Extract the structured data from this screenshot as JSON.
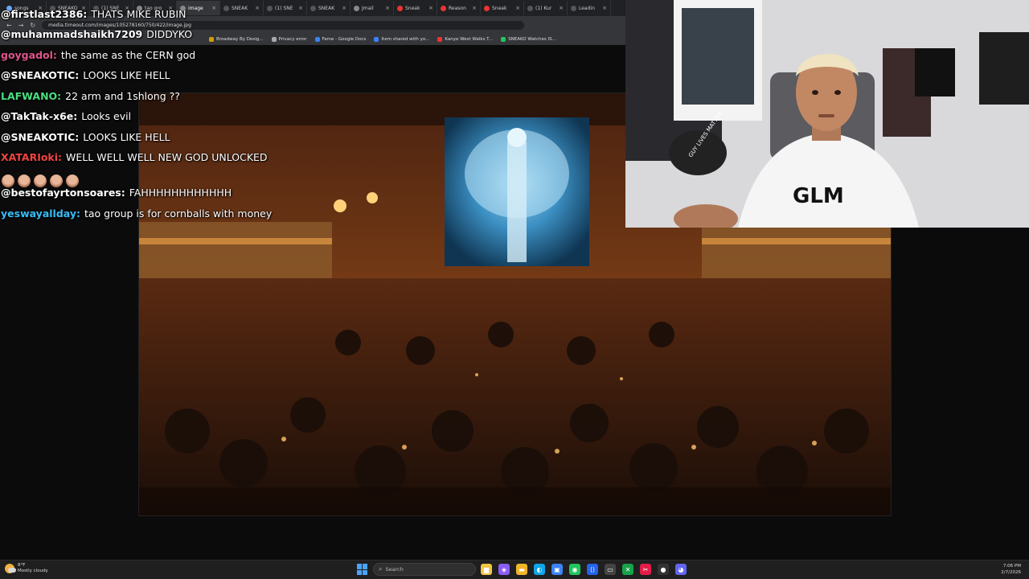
{
  "browser": {
    "tabs": [
      {
        "label": "songs",
        "icon": "music-icon",
        "color": "#6aa9ff"
      },
      {
        "label": "SNEAKO",
        "icon": "x-icon",
        "color": "#555"
      },
      {
        "label": "(1) SNE",
        "icon": "x-icon",
        "color": "#555"
      },
      {
        "label": "tao gro",
        "icon": "globe-icon",
        "color": "#888"
      },
      {
        "label": "image",
        "icon": "image-icon",
        "color": "#888",
        "active": true
      },
      {
        "label": "SNEAK",
        "icon": "x-icon",
        "color": "#555"
      },
      {
        "label": "(1) SNE",
        "icon": "x-icon",
        "color": "#555"
      },
      {
        "label": "SNEAK",
        "icon": "x-icon",
        "color": "#555"
      },
      {
        "label": "Jmail",
        "icon": "mail-icon",
        "color": "#888"
      },
      {
        "label": "Sneak",
        "icon": "youtube-icon",
        "color": "#e33"
      },
      {
        "label": "Reason",
        "icon": "youtube-icon",
        "color": "#e33"
      },
      {
        "label": "Sneak",
        "icon": "youtube-icon",
        "color": "#e33"
      },
      {
        "label": "(1) Kur",
        "icon": "x-icon",
        "color": "#555"
      },
      {
        "label": "Leadin",
        "icon": "x-icon",
        "color": "#555"
      }
    ],
    "url": "media.timeout.com/images/105278160/750/422/image.jpg",
    "bookmarks": [
      {
        "label": "Broadway By Desig...",
        "color": "#d0a000"
      },
      {
        "label": "Privacy error",
        "color": "#aaa"
      },
      {
        "label": "Fame - Google Docs",
        "color": "#3b82f6"
      },
      {
        "label": "Item shared with yo...",
        "color": "#3b82f6"
      },
      {
        "label": "Kanye West Walks T...",
        "color": "#e33"
      },
      {
        "label": "SNEAKO Watches IS...",
        "color": "#22c55e"
      }
    ]
  },
  "chat": {
    "messages": [
      {
        "user": "@firstlast2386:",
        "text": "THATS MIKE RUBIN",
        "color": "#ffffff"
      },
      {
        "user": "@muhammadshaikh7209",
        "text": "DIDDYKO",
        "color": "#ffffff"
      },
      {
        "user": "goygadol:",
        "text": "the same as the CERN god",
        "color": "#e0558a"
      },
      {
        "user": "@SNEAKOTIC:",
        "text": "LOOKS LIKE HELL",
        "color": "#ffffff"
      },
      {
        "user": "LAFWANO:",
        "text": "22 arm and 1shlong ??",
        "color": "#4ade80"
      },
      {
        "user": "@TakTak-x6e:",
        "text": "Looks evil",
        "color": "#ffffff"
      },
      {
        "user": "@SNEAKOTIC:",
        "text": "LOOKS LIKE HELL",
        "color": "#ffffff"
      },
      {
        "user": "XATARIoki:",
        "text": "WELL WELL WELL NEW GOD UNLOCKED",
        "color": "#ef4444"
      },
      {
        "user": "@bestofayrtonsoares:",
        "text": "FAHHHHHHHHHHHH",
        "color": "#ffffff"
      },
      {
        "user": "yeswayallday:",
        "text": "tao group is for cornballs with money",
        "color": "#38bdf8"
      }
    ]
  },
  "webcam": {
    "shirt_text": "GLM",
    "hat_text": "GUY LIVES MATTER"
  },
  "taskbar": {
    "weather_temp": "8°F",
    "weather_desc": "Mostly cloudy",
    "search_placeholder": "Search",
    "time": "7:06 PM",
    "date": "2/7/2026",
    "apps": [
      {
        "name": "file-explorer-icon",
        "color": "#f5c542",
        "glyph": "▆"
      },
      {
        "name": "copilot-icon",
        "color": "#8b5cf6",
        "glyph": "◈"
      },
      {
        "name": "folder-icon",
        "color": "#f0b429",
        "glyph": "▬"
      },
      {
        "name": "edge-icon",
        "color": "#0ea5e9",
        "glyph": "◐"
      },
      {
        "name": "store-icon",
        "color": "#3b82f6",
        "glyph": "▣"
      },
      {
        "name": "chrome-icon",
        "color": "#22c55e",
        "glyph": "◉"
      },
      {
        "name": "vscode-icon",
        "color": "#2563eb",
        "glyph": "⟨⟩"
      },
      {
        "name": "terminal-icon",
        "color": "#444",
        "glyph": "▭"
      },
      {
        "name": "xbox-icon",
        "color": "#16a34a",
        "glyph": "✕"
      },
      {
        "name": "snipping-icon",
        "color": "#e11d48",
        "glyph": "✂"
      },
      {
        "name": "obs-icon",
        "color": "#333",
        "glyph": "●"
      },
      {
        "name": "discord-icon",
        "color": "#6366f1",
        "glyph": "◕"
      }
    ]
  }
}
